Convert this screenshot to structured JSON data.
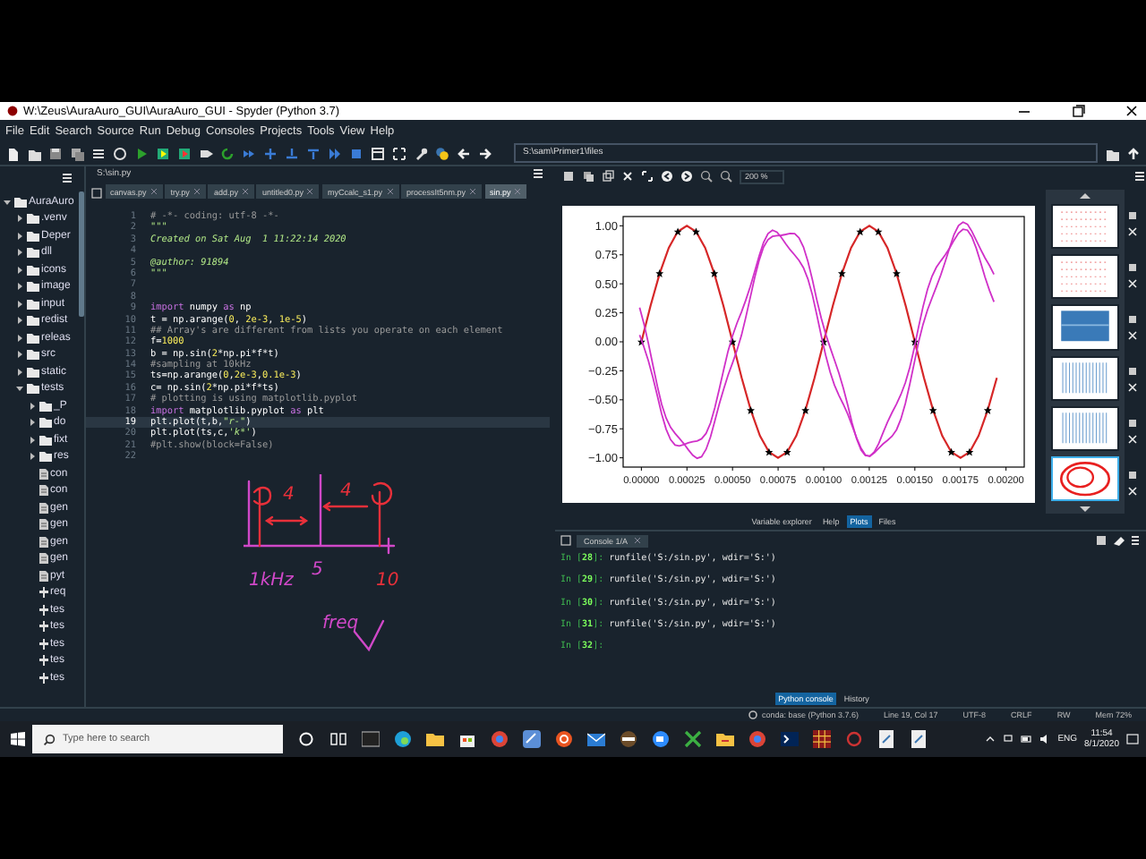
{
  "window": {
    "title": "W:\\Zeus\\AuraAuro_GUI\\AuraAuro_GUI - Spyder (Python 3.7)"
  },
  "menu": [
    "File",
    "Edit",
    "Search",
    "Source",
    "Run",
    "Debug",
    "Consoles",
    "Projects",
    "Tools",
    "View",
    "Help"
  ],
  "toolbar": {
    "path": "S:\\sam\\Primer1\\files"
  },
  "file_tree": [
    {
      "name": "AuraAuro",
      "kind": "folder",
      "expanded": true,
      "children": [
        {
          "name": ".venv",
          "kind": "folder",
          "expanded": false
        },
        {
          "name": "Deper",
          "kind": "folder",
          "expanded": false
        },
        {
          "name": "dll",
          "kind": "folder",
          "expanded": false
        },
        {
          "name": "icons",
          "kind": "folder",
          "expanded": false
        },
        {
          "name": "image",
          "kind": "folder",
          "expanded": false
        },
        {
          "name": "input",
          "kind": "folder",
          "expanded": false
        },
        {
          "name": "redist",
          "kind": "folder",
          "expanded": false
        },
        {
          "name": "releas",
          "kind": "folder",
          "expanded": false
        },
        {
          "name": "src",
          "kind": "folder",
          "expanded": false
        },
        {
          "name": "static",
          "kind": "folder",
          "expanded": false
        },
        {
          "name": "tests",
          "kind": "folder",
          "expanded": true,
          "children": [
            {
              "name": "_P",
              "kind": "folder",
              "expanded": false
            },
            {
              "name": "do",
              "kind": "folder",
              "expanded": false
            },
            {
              "name": "fixt",
              "kind": "folder",
              "expanded": false
            },
            {
              "name": "res",
              "kind": "folder",
              "expanded": false
            },
            {
              "name": "con",
              "kind": "file"
            },
            {
              "name": "con",
              "kind": "file"
            },
            {
              "name": "gen",
              "kind": "file"
            },
            {
              "name": "gen",
              "kind": "file"
            },
            {
              "name": "gen",
              "kind": "file"
            },
            {
              "name": "gen",
              "kind": "file"
            },
            {
              "name": "pyt",
              "kind": "file"
            },
            {
              "name": "req",
              "kind": "text"
            },
            {
              "name": "tes",
              "kind": "text"
            },
            {
              "name": "tes",
              "kind": "text"
            },
            {
              "name": "tes",
              "kind": "text"
            },
            {
              "name": "tes",
              "kind": "text"
            },
            {
              "name": "tes",
              "kind": "text"
            }
          ]
        }
      ]
    }
  ],
  "editor": {
    "file_path": "S:\\sin.py",
    "tabs": [
      {
        "label": "canvas.py",
        "selected": false
      },
      {
        "label": "try.py",
        "selected": false
      },
      {
        "label": "add.py",
        "selected": false
      },
      {
        "label": "untitled0.py",
        "selected": false
      },
      {
        "label": "myCcalc_s1.py",
        "selected": false
      },
      {
        "label": "processIt5nm.py",
        "selected": false
      },
      {
        "label": "sin.py",
        "selected": true
      }
    ],
    "lines": [
      {
        "number": "1",
        "current": false,
        "parts": [
          {
            "text": "# -*- coding: utf-8 -*-",
            "kind": "comment"
          }
        ]
      },
      {
        "number": "2",
        "current": false,
        "parts": [
          {
            "text": "\"\"\"",
            "kind": "string"
          }
        ]
      },
      {
        "number": "3",
        "current": false,
        "parts": [
          {
            "text": "Created on Sat Aug  1 11:22:14 2020",
            "kind": "string"
          }
        ]
      },
      {
        "number": "4",
        "current": false
      },
      {
        "number": "5",
        "current": false,
        "parts": [
          {
            "text": "@author: 91894",
            "kind": "string"
          }
        ]
      },
      {
        "number": "6",
        "current": false,
        "parts": [
          {
            "text": "\"\"\"",
            "kind": "string"
          }
        ]
      },
      {
        "number": "7",
        "current": false
      },
      {
        "number": "8",
        "current": false
      },
      {
        "number": "9",
        "current": false,
        "parts": [
          {
            "text": "import",
            "kind": "keyword"
          },
          {
            "text": " numpy ",
            "kind": "plain"
          },
          {
            "text": "as",
            "kind": "keyword"
          },
          {
            "text": " np",
            "kind": "plain"
          }
        ]
      },
      {
        "number": "10",
        "current": false,
        "parts": [
          {
            "text": "t = np.arange(",
            "kind": "plain"
          },
          {
            "text": "0",
            "kind": "number"
          },
          {
            "text": ", ",
            "kind": "plain"
          },
          {
            "text": "2e-3",
            "kind": "number"
          },
          {
            "text": ", ",
            "kind": "plain"
          },
          {
            "text": "1e-5",
            "kind": "number"
          },
          {
            "text": ")",
            "kind": "plain"
          }
        ]
      },
      {
        "number": "11",
        "current": false,
        "parts": [
          {
            "text": "## Array's are different from lists you operate on each element",
            "kind": "comment"
          }
        ]
      },
      {
        "number": "12",
        "current": false,
        "parts": [
          {
            "text": "f=",
            "kind": "plain"
          },
          {
            "text": "1000",
            "kind": "number"
          }
        ]
      },
      {
        "number": "13",
        "current": false,
        "parts": [
          {
            "text": "b = np.sin(",
            "kind": "plain"
          },
          {
            "text": "2",
            "kind": "number"
          },
          {
            "text": "*np.pi*f*t)",
            "kind": "plain"
          }
        ]
      },
      {
        "number": "14",
        "current": false,
        "parts": [
          {
            "text": "#sampling at 10kHz",
            "kind": "comment"
          }
        ]
      },
      {
        "number": "15",
        "current": false,
        "parts": [
          {
            "text": "ts=np.arange(",
            "kind": "plain"
          },
          {
            "text": "0",
            "kind": "number"
          },
          {
            "text": ",",
            "kind": "plain"
          },
          {
            "text": "2e-3",
            "kind": "number"
          },
          {
            "text": ",",
            "kind": "plain"
          },
          {
            "text": "0.1e-3",
            "kind": "number"
          },
          {
            "text": ")",
            "kind": "plain"
          }
        ]
      },
      {
        "number": "16",
        "current": false,
        "parts": [
          {
            "text": "c= np.sin(",
            "kind": "plain"
          },
          {
            "text": "2",
            "kind": "number"
          },
          {
            "text": "*np.pi*f*ts)",
            "kind": "plain"
          }
        ]
      },
      {
        "number": "17",
        "current": false,
        "parts": [
          {
            "text": "# plotting is using matplotlib.pyplot",
            "kind": "comment"
          }
        ]
      },
      {
        "number": "18",
        "current": false,
        "parts": [
          {
            "text": "import",
            "kind": "keyword"
          },
          {
            "text": " matplotlib.pyplot ",
            "kind": "plain"
          },
          {
            "text": "as",
            "kind": "keyword"
          },
          {
            "text": " plt",
            "kind": "plain"
          }
        ]
      },
      {
        "number": "19",
        "current": true,
        "parts": [
          {
            "text": "plt.plot(t,b,",
            "kind": "plain"
          },
          {
            "text": "\"r-\"",
            "kind": "string"
          },
          {
            "text": ")",
            "kind": "plain"
          }
        ]
      },
      {
        "number": "20",
        "current": false,
        "parts": [
          {
            "text": "plt.plot(ts,c,",
            "kind": "plain"
          },
          {
            "text": "'k*'",
            "kind": "string"
          },
          {
            "text": ")",
            "kind": "plain"
          }
        ]
      },
      {
        "number": "21",
        "current": false,
        "parts": [
          {
            "text": "#plt.show(block=False)",
            "kind": "comment"
          }
        ]
      },
      {
        "number": "22",
        "current": false
      }
    ],
    "sketch_labels": [
      "4",
      "4",
      "1kHz",
      "5",
      "10",
      "freq"
    ]
  },
  "plots": {
    "zoom": "200 %",
    "chart_data": {
      "type": "line",
      "xlim": [
        -0.0001,
        0.0021
      ],
      "ylim": [
        -1.08,
        1.08
      ],
      "xticks": [
        {
          "value": 0,
          "label": "0.00000"
        },
        {
          "value": 0.00025,
          "label": "0.00025"
        },
        {
          "value": 0.0005,
          "label": "0.00050"
        },
        {
          "value": 0.00075,
          "label": "0.00075"
        },
        {
          "value": 0.001,
          "label": "0.00100"
        },
        {
          "value": 0.00125,
          "label": "0.00125"
        },
        {
          "value": 0.0015,
          "label": "0.00150"
        },
        {
          "value": 0.00175,
          "label": "0.00175"
        },
        {
          "value": 0.002,
          "label": "0.00200"
        }
      ],
      "yticks": [
        {
          "value": 1,
          "label": "1.00"
        },
        {
          "value": 0.75,
          "label": "0.75"
        },
        {
          "value": 0.5,
          "label": "0.50"
        },
        {
          "value": 0.25,
          "label": "0.25"
        },
        {
          "value": 0,
          "label": "0.00"
        },
        {
          "value": -0.25,
          "label": "−0.25"
        },
        {
          "value": -0.5,
          "label": "−0.50"
        },
        {
          "value": -0.75,
          "label": "−0.75"
        },
        {
          "value": -1,
          "label": "−1.00"
        }
      ],
      "x": [
        0,
        5e-05,
        0.0001,
        0.00015,
        0.0002,
        0.00025,
        0.0003,
        0.00035,
        0.0004,
        0.00045,
        0.0005,
        0.00055,
        0.0006,
        0.00065,
        0.0007,
        0.00075,
        0.0008,
        0.00085,
        0.0009,
        0.00095,
        0.001,
        0.00105,
        0.0011,
        0.00115,
        0.0012,
        0.00125,
        0.0013,
        0.00135,
        0.0014,
        0.00145,
        0.0015,
        0.00155,
        0.0016,
        0.00165,
        0.0017,
        0.00175,
        0.0018,
        0.00185,
        0.0019,
        0.00195
      ],
      "series": [
        {
          "color": "#d62728",
          "values": [
            0,
            0.31,
            0.59,
            0.81,
            0.95,
            1,
            0.95,
            0.81,
            0.59,
            0.31,
            0,
            -0.31,
            -0.59,
            -0.81,
            -0.95,
            -1,
            -0.95,
            -0.81,
            -0.59,
            -0.31,
            0,
            0.31,
            0.59,
            0.81,
            0.95,
            1,
            0.95,
            0.81,
            0.59,
            0.31,
            0,
            -0.31,
            -0.59,
            -0.81,
            -0.95,
            -1,
            -0.95,
            -0.81,
            -0.59,
            -0.31
          ]
        },
        {
          "color": "#000000",
          "type": "scatter",
          "values": [
            0,
            null,
            0.59,
            null,
            0.95,
            null,
            0.95,
            null,
            0.59,
            null,
            0,
            null,
            -0.59,
            null,
            -0.95,
            null,
            -0.95,
            null,
            -0.59,
            null,
            0,
            null,
            0.59,
            null,
            0.95,
            null,
            0.95,
            null,
            0.59,
            null,
            0,
            null,
            -0.59,
            null,
            -0.95,
            null,
            -0.95,
            null,
            -0.59,
            null
          ]
        }
      ]
    },
    "thumbnails": [
      {
        "kind": "dots",
        "selected": false
      },
      {
        "kind": "dots",
        "selected": false
      },
      {
        "kind": "filled",
        "selected": false
      },
      {
        "kind": "bars",
        "selected": false
      },
      {
        "kind": "bars",
        "selected": false
      },
      {
        "kind": "scribble",
        "selected": true
      }
    ]
  },
  "pane_tabs": [
    {
      "label": "Variable explorer",
      "selected": false
    },
    {
      "label": "Help",
      "selected": false
    },
    {
      "label": "Plots",
      "selected": true
    },
    {
      "label": "Files",
      "selected": false
    }
  ],
  "console": {
    "tab": "Console 1/A",
    "entries": [
      {
        "prompt": "In [**28**]:",
        "command": "runfile('S:/sin.py', wdir='S:')"
      },
      {
        "prompt": "In [**29**]:",
        "command": "runfile('S:/sin.py', wdir='S:')"
      },
      {
        "prompt": "In [**30**]:",
        "command": "runfile('S:/sin.py', wdir='S:')"
      },
      {
        "prompt": "In [**31**]:",
        "command": "runfile('S:/sin.py', wdir='S:')"
      },
      {
        "prompt": "In [**32**]:"
      }
    ],
    "tabs": [
      {
        "label": "Python console",
        "selected": true
      },
      {
        "label": "History",
        "selected": false
      }
    ]
  },
  "status_bar": [
    "conda: base (Python 3.7.6)",
    "Line 19, Col 17",
    "UTF-8",
    "CRLF",
    "RW",
    "Mem 72%"
  ],
  "taskbar": {
    "search_placeholder": "Type here to search",
    "language": "ENG",
    "time": "11:54",
    "date": "8/1/2020"
  }
}
